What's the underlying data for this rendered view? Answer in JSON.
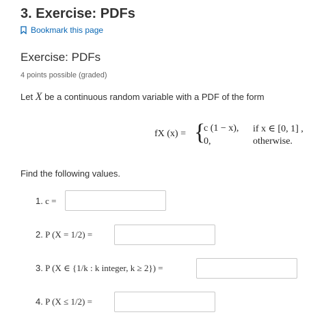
{
  "page": {
    "title": "3. Exercise: PDFs",
    "bookmark_label": "Bookmark this page"
  },
  "problem": {
    "header": "Exercise: PDFs",
    "points": "4 points possible (graded)",
    "prompt_prefix": "Let ",
    "prompt_var": "X",
    "prompt_suffix": " be a continuous random variable with a PDF of the form",
    "formula": {
      "lhs": "fX (x) =",
      "case1_value": "c (1 − x),",
      "case1_condition": "if x ∈ [0, 1] ,",
      "case2_value": "0,",
      "case2_condition": "otherwise."
    },
    "find_text": "Find the following values."
  },
  "questions": [
    {
      "number": "1.",
      "expr": "c =",
      "input_value": ""
    },
    {
      "number": "2.",
      "expr": "P (X = 1/2) =",
      "input_value": ""
    },
    {
      "number": "3.",
      "expr": "P (X ∈ {1/k : k integer, k ≥ 2}) =",
      "input_value": ""
    },
    {
      "number": "4.",
      "expr": "P (X ≤ 1/2) =",
      "input_value": ""
    }
  ],
  "colors": {
    "text": "#313131",
    "link": "#0a67b4",
    "muted": "#646464",
    "input_border": "#c8c8c8"
  }
}
